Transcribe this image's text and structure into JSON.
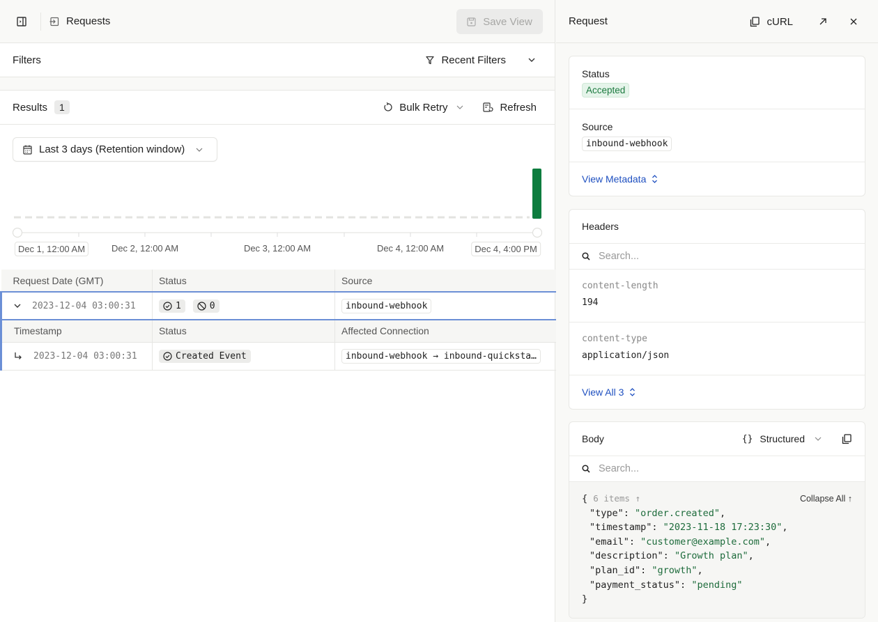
{
  "topbar": {
    "title": "Requests",
    "save_view_label": "Save View"
  },
  "filters": {
    "label": "Filters",
    "recent_filters_label": "Recent Filters"
  },
  "results": {
    "label": "Results",
    "count": "1",
    "bulk_retry_label": "Bulk Retry",
    "refresh_label": "Refresh"
  },
  "date_range": {
    "selected": "Last 3 days (Retention window)"
  },
  "timeline": {
    "start_label": "Dec 1, 12:00 AM",
    "end_label": "Dec 4, 4:00 PM",
    "ticks": [
      "Dec 2, 12:00 AM",
      "Dec 3, 12:00 AM",
      "Dec 4, 12:00 AM"
    ],
    "bar_color": "#0e7d3f",
    "bars": [
      {
        "bucket": "Dec 4 (last)",
        "count": 1
      }
    ]
  },
  "table": {
    "columns": [
      "Request Date (GMT)",
      "Status",
      "Source"
    ],
    "rows": [
      {
        "date": "2023-12-04 03:00:31",
        "accepted_count": "1",
        "ignored_count": "0",
        "source": "inbound-webhook"
      }
    ],
    "sub_columns": [
      "Timestamp",
      "Status",
      "Affected Connection"
    ],
    "sub_rows": [
      {
        "timestamp": "2023-12-04 03:00:31",
        "status": "Created Event",
        "connection": "inbound-webhook → inbound-quicksta…"
      }
    ]
  },
  "request_panel": {
    "title": "Request",
    "curl_label": "cURL",
    "status_label": "Status",
    "status_value": "Accepted",
    "source_label": "Source",
    "source_value": "inbound-webhook",
    "view_metadata_label": "View Metadata",
    "headers": {
      "title": "Headers",
      "search_placeholder": "Search...",
      "items": [
        {
          "key": "content-length",
          "value": "194"
        },
        {
          "key": "content-type",
          "value": "application/json"
        }
      ],
      "view_all_label": "View All 3"
    },
    "body": {
      "title": "Body",
      "mode_label": "Structured",
      "search_placeholder": "Search...",
      "items_meta": "6 items ↑",
      "collapse_all_label": "Collapse All ↑",
      "fields": [
        {
          "key": "\"type\"",
          "value": "\"order.created\"",
          "sep": ","
        },
        {
          "key": "\"timestamp\"",
          "value": "\"2023-11-18 17:23:30\"",
          "sep": ","
        },
        {
          "key": "\"email\"",
          "value": "\"customer@example.com\"",
          "sep": ","
        },
        {
          "key": "\"description\"",
          "value": "\"Growth plan\"",
          "sep": ","
        },
        {
          "key": "\"plan_id\"",
          "value": "\"growth\"",
          "sep": ","
        },
        {
          "key": "\"payment_status\"",
          "value": "\"pending\"",
          "sep": ""
        }
      ]
    }
  }
}
